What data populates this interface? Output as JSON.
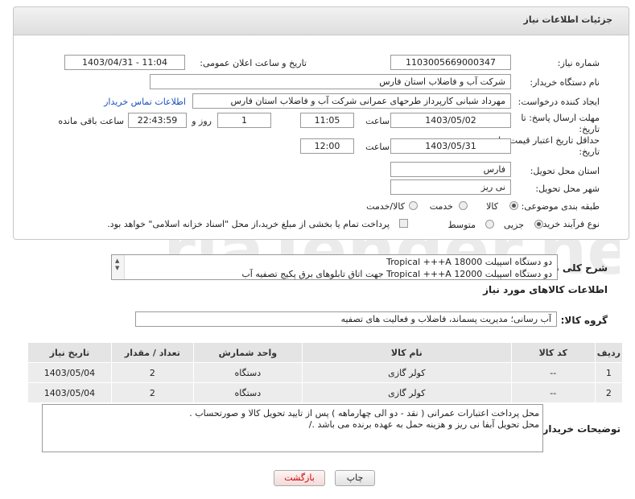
{
  "header": {
    "title": "جزئیات اطلاعات نیاز"
  },
  "form": {
    "need_number_label": "شماره نیاز:",
    "need_number": "1103005669000347",
    "announce_label": "تاریخ و ساعت اعلان عمومی:",
    "announce_value": "1403/04/31 - 11:04",
    "buyer_label": "نام دستگاه خریدار:",
    "buyer_value": "شرکت آب و فاضلاب استان فارس",
    "creator_label": "ایجاد کننده درخواست:",
    "creator_value": "مهرداد شبانی کارپرداز طرحهای عمرانی  شرکت آب و فاضلاب استان فارس",
    "contact_link": "اطلاعات تماس خریدار",
    "deadline_label_1": "مهلت ارسال پاسخ: تا",
    "deadline_label_2": "تاریخ:",
    "deadline_date": "1403/05/02",
    "time_label": "ساعت",
    "deadline_time": "11:05",
    "days_value": "1",
    "days_label": "روز و",
    "remaining_time": "22:43:59",
    "remaining_label": "ساعت باقی مانده",
    "validity_label_1": "حداقل تاریخ اعتبار قیمت: تا",
    "validity_label_2": "تاریخ:",
    "validity_date": "1403/05/31",
    "validity_time": "12:00",
    "province_label": "استان محل تحویل:",
    "province_value": "فارس",
    "city_label": "شهر محل تحویل:",
    "city_value": "نی ریز",
    "category_label": "طبقه بندی موضوعی:",
    "category_options": [
      "کالا",
      "خدمت",
      "کالا/خدمت"
    ],
    "process_label": "نوع فرآیند خرید :",
    "process_options": [
      "جزیی",
      "متوسط"
    ],
    "payment_note": "پرداخت تمام یا بخشی از مبلغ خرید،از محل \"اسناد خزانه اسلامی\" خواهد بود."
  },
  "description": {
    "label": "شرح کلی نیاز:",
    "line1": "دو دستگاه اسپیلت 18000 Tropical +++A",
    "line2": "دو دستگاه اسپیلت 12000 Tropical +++A جهت اتاق تابلوهای برق پکیج تصفیه آب"
  },
  "goods": {
    "section_title": "اطلاعات کالاهای مورد نیاز",
    "group_label": "گروه کالا:",
    "group_value": "آب رسانی؛ مدیریت پسماند، فاضلاب و فعالیت های تصفیه",
    "columns": [
      "ردیف",
      "کد کالا",
      "نام کالا",
      "واحد شمارش",
      "تعداد / مقدار",
      "تاریخ نیاز"
    ],
    "rows": [
      {
        "row": "1",
        "code": "--",
        "name": "کولر گازی",
        "unit": "دستگاه",
        "qty": "2",
        "date": "1403/05/04"
      },
      {
        "row": "2",
        "code": "--",
        "name": "کولر گازی",
        "unit": "دستگاه",
        "qty": "2",
        "date": "1403/05/04"
      }
    ]
  },
  "buyer_notes": {
    "label": "توضیحات خریدار:",
    "line1": "محل پرداخت اعتبارات عمرانی  ( نقد -  دو الی چهارماهه ) پس از تایید تحویل کالا و صورتحساب .",
    "line2": "محل تحویل آبفا  نی ریز   و هزینه حمل به عهده برنده می باشد ./"
  },
  "buttons": {
    "print": "چاپ",
    "back": "بازگشت"
  },
  "watermark": {
    "text": "AriaTender.neT"
  }
}
